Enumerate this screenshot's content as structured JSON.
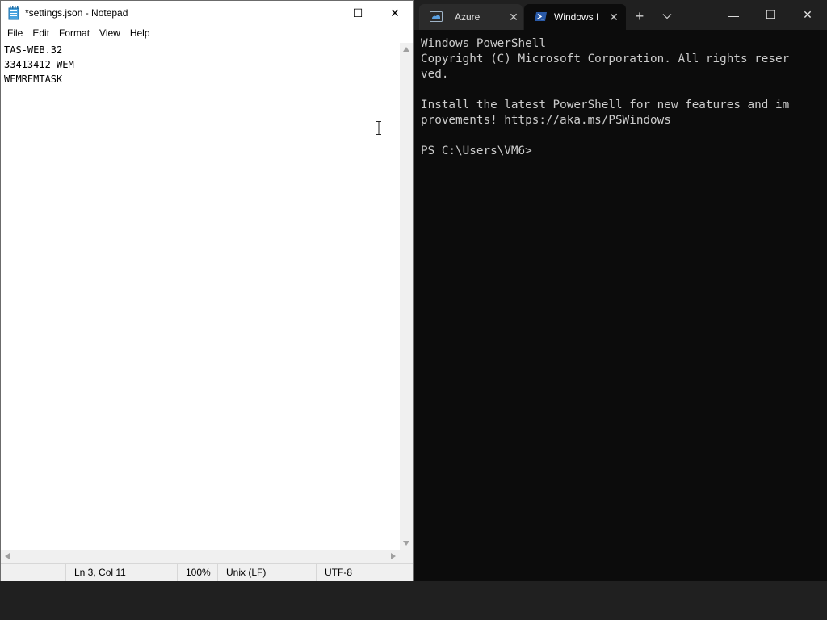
{
  "notepad": {
    "title": "*settings.json - Notepad",
    "menu": [
      "File",
      "Edit",
      "Format",
      "View",
      "Help"
    ],
    "lines": [
      "TAS-WEB.32",
      "33413412-WEM",
      "WEMREMTASK"
    ],
    "status": {
      "position": "Ln 3, Col 11",
      "zoom": "100%",
      "line_ending": "Unix (LF)",
      "encoding": "UTF-8"
    },
    "controls": {
      "minimize": "—",
      "maximize": "☐",
      "close": "✕"
    }
  },
  "terminal": {
    "tabs": [
      {
        "label": "Azure",
        "icon": "azure-cloud-shell-icon",
        "active": false
      },
      {
        "label": "Windows I",
        "icon": "powershell-icon",
        "active": true
      }
    ],
    "new_tab": "+",
    "controls": {
      "minimize": "—",
      "maximize": "☐",
      "close": "✕"
    },
    "lines": [
      "Windows PowerShell",
      "Copyright (C) Microsoft Corporation. All rights reser",
      "ved.",
      "",
      "Install the latest PowerShell for new features and im",
      "provements! https://aka.ms/PSWindows",
      "",
      "PS C:\\Users\\VM6>"
    ],
    "colors": {
      "background": "#0c0c0c",
      "text": "#cccccc",
      "tabbar": "#202020"
    }
  }
}
